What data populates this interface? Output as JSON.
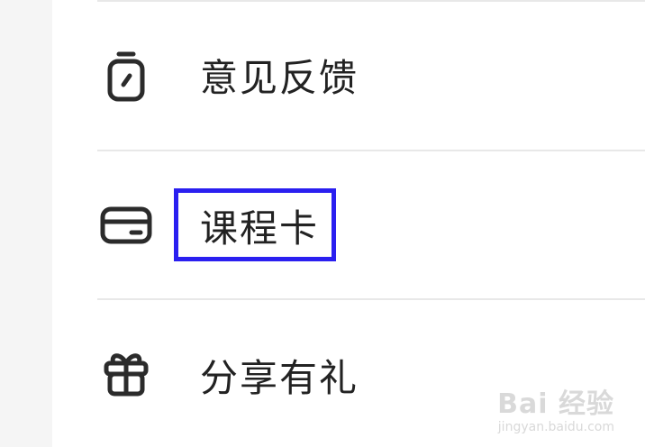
{
  "menu": {
    "items": [
      {
        "label": "意见反馈",
        "icon": "stopwatch-icon"
      },
      {
        "label": "课程卡",
        "icon": "card-icon",
        "highlighted": true
      },
      {
        "label": "分享有礼",
        "icon": "gift-icon"
      }
    ]
  },
  "highlight": {
    "color": "#2a1ff0"
  },
  "watermark": {
    "text": "Bai 经验",
    "url": "jingyan.baidu.com"
  }
}
